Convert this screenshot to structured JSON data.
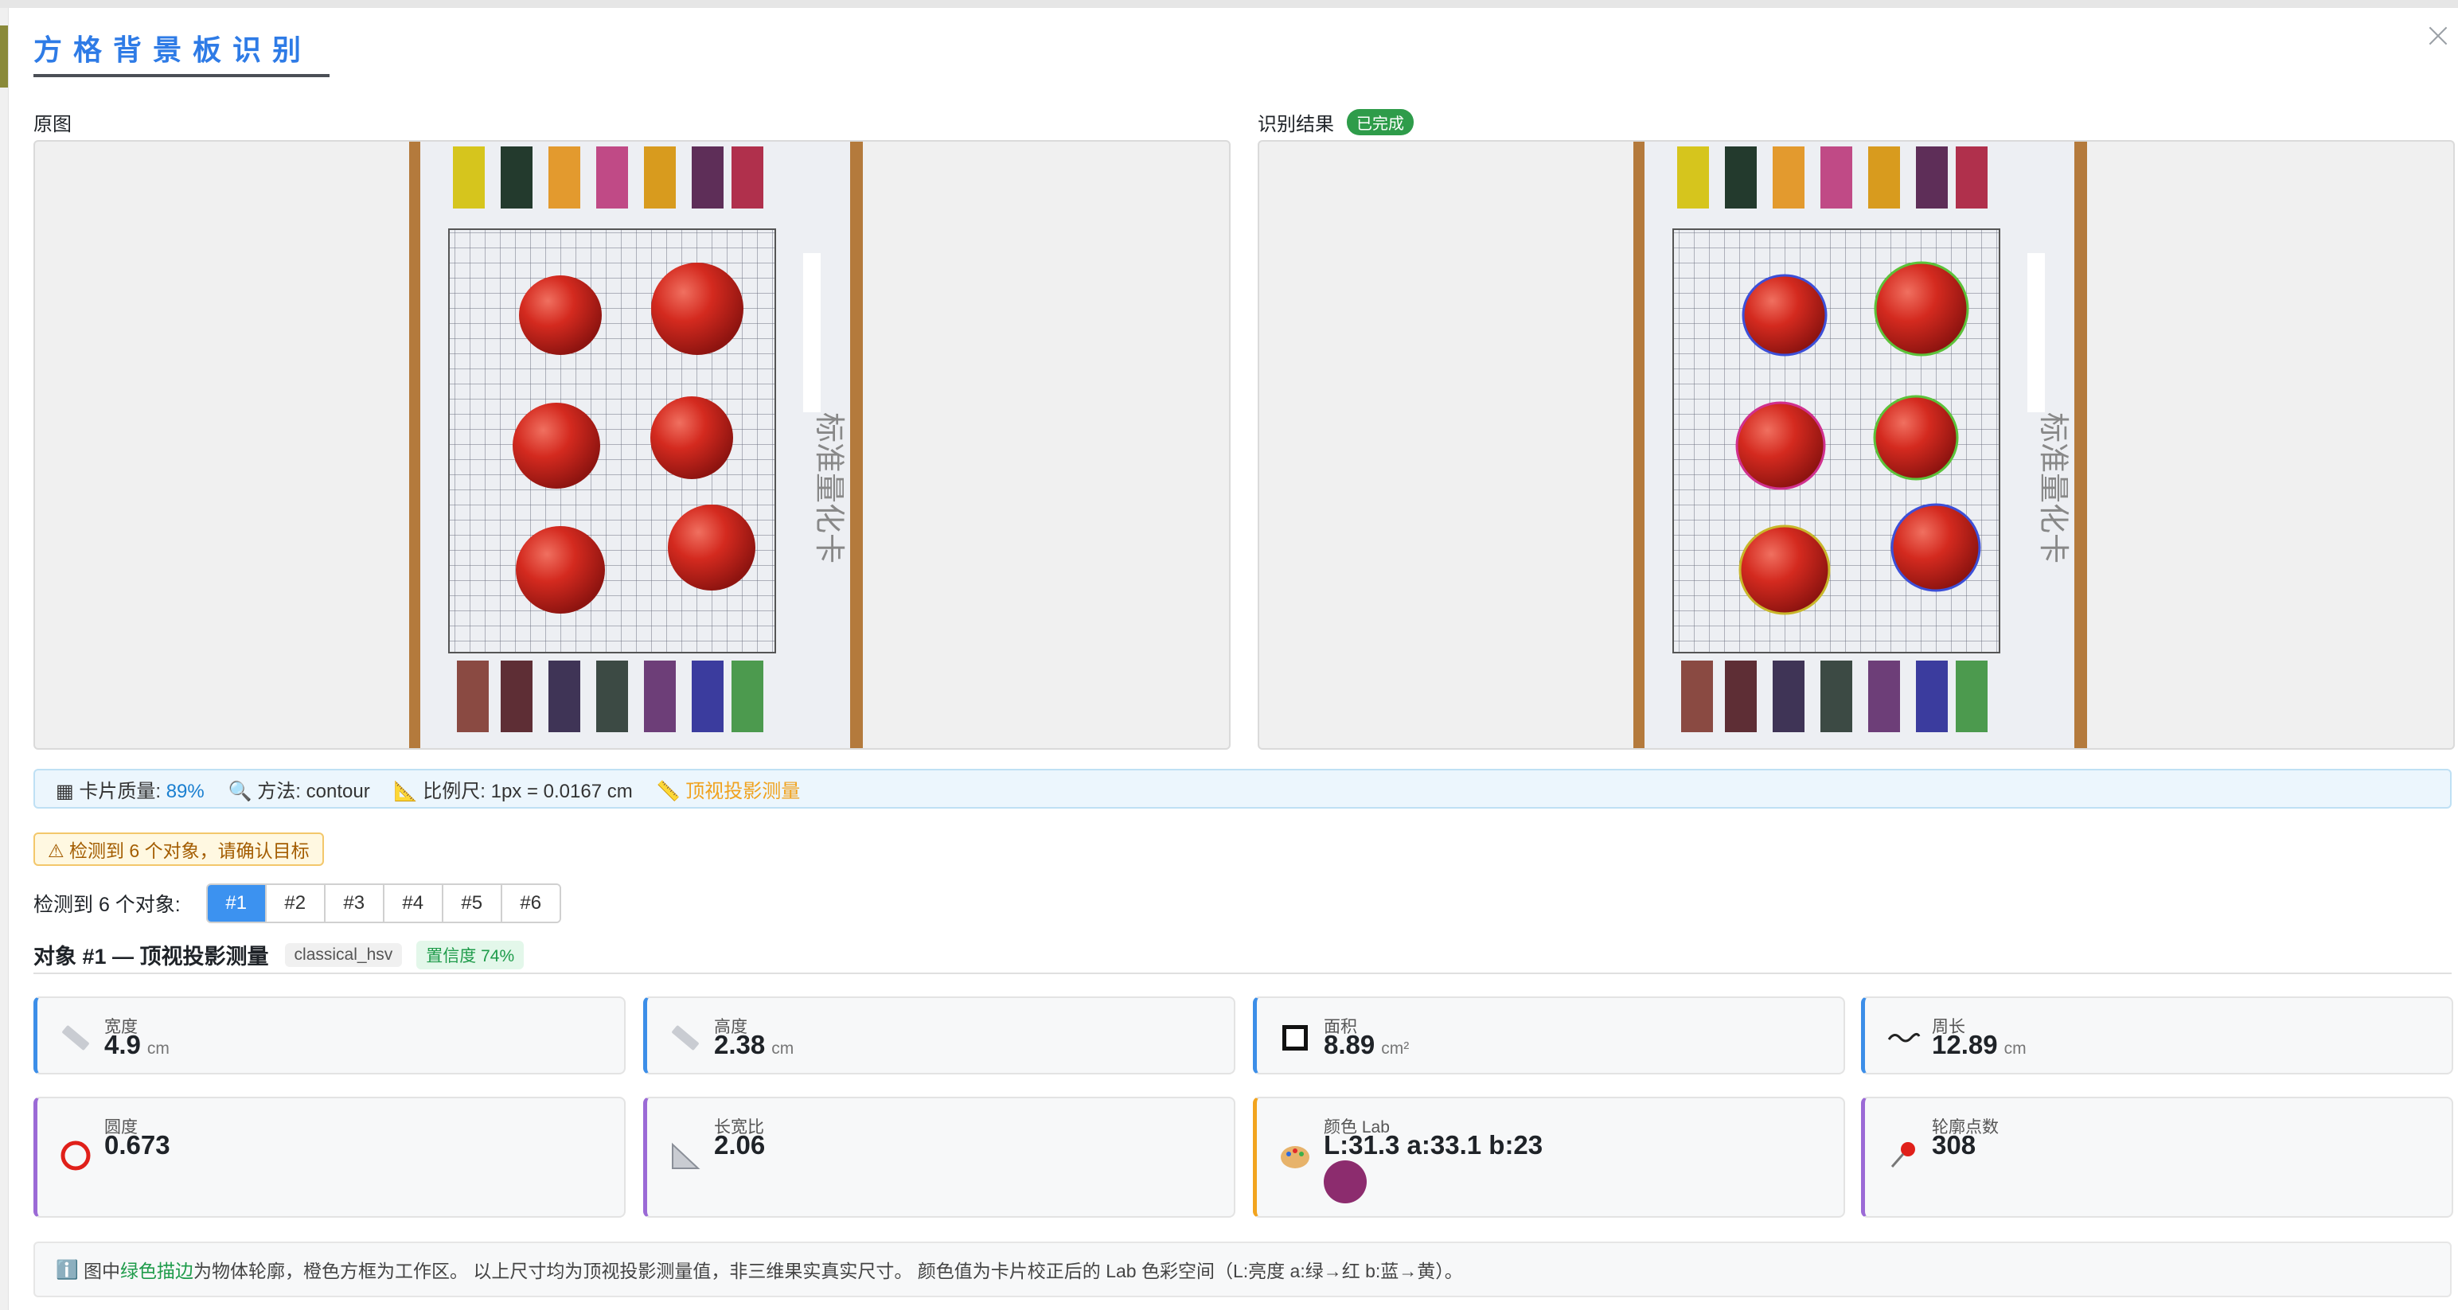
{
  "dialog": {
    "title": "方格背景板识别"
  },
  "panels": {
    "original_label": "原图",
    "result_label": "识别结果",
    "result_status": "已完成"
  },
  "info_bar": {
    "quality_label": "卡片质量:",
    "quality_value": "89%",
    "method_label": "方法:",
    "method_value": "contour",
    "scale_label": "比例尺:",
    "scale_value": "1px = 0.0167 cm",
    "mode": "顶视投影测量"
  },
  "warning": "⚠ 检测到 6 个对象，请确认目标",
  "objects": {
    "label": "检测到 6 个对象:",
    "tabs": [
      "#1",
      "#2",
      "#3",
      "#4",
      "#5",
      "#6"
    ],
    "active": "#1"
  },
  "object_header": {
    "title": "对象 #1 — 顶视投影测量",
    "algorithm": "classical_hsv",
    "confidence": "置信度 74%"
  },
  "metrics": {
    "width": {
      "label": "宽度",
      "value": "4.9",
      "unit": "cm",
      "icon": "ruler-icon"
    },
    "height": {
      "label": "高度",
      "value": "2.38",
      "unit": "cm",
      "icon": "ruler-icon"
    },
    "area": {
      "label": "面积",
      "value": "8.89",
      "unit": "cm²",
      "icon": "square-icon"
    },
    "perimeter": {
      "label": "周长",
      "value": "12.89",
      "unit": "cm",
      "icon": "wave-icon"
    },
    "roundness": {
      "label": "圆度",
      "value": "0.673",
      "icon": "circle-icon"
    },
    "aspect_ratio": {
      "label": "长宽比",
      "value": "2.06",
      "icon": "triangle-ruler-icon"
    },
    "color": {
      "label": "颜色 Lab",
      "value": "L:31.3 a:33.1 b:23",
      "swatch": "#8c2c6e",
      "icon": "palette-icon"
    },
    "contour_points": {
      "label": "轮廓点数",
      "value": "308",
      "icon": "pin-icon"
    }
  },
  "note": {
    "icon": "info-icon",
    "prefix": "图中",
    "highlight": "绿色描边",
    "suffix": "为物体轮廓，橙色方框为工作区。 以上尺寸均为顶视投影测量值，非三维果实真实尺寸。 颜色值为卡片校正后的 Lab 色彩空间（L:亮度 a:绿→红 b:蓝→黄）。"
  },
  "colors": {
    "accent": "#2e7be6",
    "success": "#2e9c4a",
    "warning": "#f0a21e",
    "swatch": "#8c2c6e"
  }
}
